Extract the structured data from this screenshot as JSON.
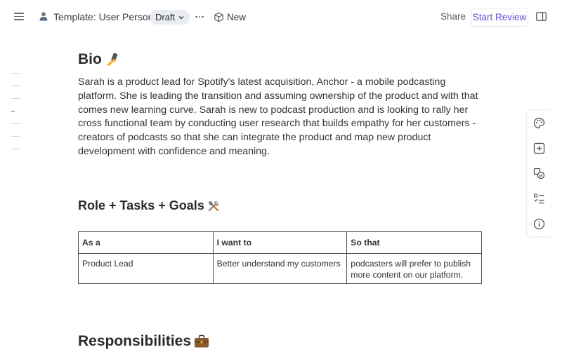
{
  "header": {
    "title": "Template: User Persona",
    "status": "Draft",
    "new_label": "New",
    "share_label": "Share",
    "review_label": "Start Review"
  },
  "icons": {
    "menu": "hamburger-icon",
    "persona": "user-icon",
    "status_dropdown": "chevron-down-icon",
    "more": "more-horizontal-icon",
    "new": "cube-icon",
    "panel": "sidebar-panel-icon",
    "rail": [
      "palette-icon",
      "add-box-icon",
      "shapes-icon",
      "checklist-icon",
      "info-icon"
    ]
  },
  "colors": {
    "accent": "#5b4fd6",
    "pill_bg": "#e9ecf2",
    "text": "#2b2b2b"
  },
  "document": {
    "bio_heading": "Bio",
    "bio_text": "Sarah is a product lead for Spotify's latest acquisition, Anchor - a mobile podcasting platform. She is leading the transition and assuming ownership of the product and with that comes new learning curve. Sarah is new to podcast production and is looking to rally her cross functional team by conducting user research that builds empathy for her customers - creators of podcasts so that she can integrate the product and map new product development with confidence and meaning.",
    "role_heading": "Role + Tasks + Goals",
    "table": {
      "headers": [
        "As a",
        "I want to",
        "So that"
      ],
      "rows": [
        [
          "Product Lead",
          "Better understand my customers",
          "podcasters will prefer to publish more content on our platform."
        ]
      ]
    },
    "responsibilities_heading": "Responsibilities"
  }
}
